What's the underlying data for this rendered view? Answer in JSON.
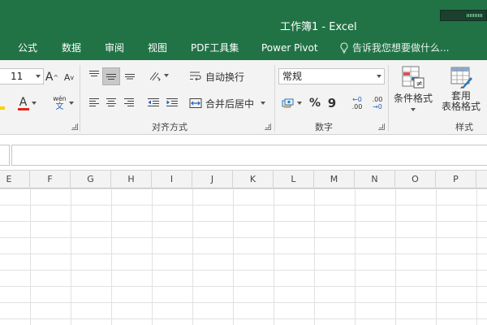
{
  "window": {
    "title": "工作簿1 - Excel"
  },
  "tabs": [
    {
      "label": "公式"
    },
    {
      "label": "数据"
    },
    {
      "label": "审阅"
    },
    {
      "label": "视图"
    },
    {
      "label": "PDF工具集"
    },
    {
      "label": "Power Pivot"
    }
  ],
  "tellme": {
    "placeholder": "告诉我您想要做什么..."
  },
  "font_group": {
    "font_size": "11",
    "phonetic_top": "wén",
    "phonetic_bottom": "文",
    "grow_label": "A",
    "shrink_label": "A",
    "font_color_label": "A"
  },
  "alignment_group": {
    "label": "对齐方式",
    "wrap_text": "自动换行",
    "merge_center": "合并后居中"
  },
  "number_group": {
    "label": "数字",
    "format": "常规",
    "percent": "%",
    "comma": "9",
    "increase_decimal": ".00",
    "decrease_decimal": ".00"
  },
  "styles_group": {
    "label": "样式",
    "conditional_formatting": "条件格式",
    "format_as_table_line1": "套用",
    "format_as_table_line2": "表格格式"
  },
  "columns": [
    "E",
    "F",
    "G",
    "H",
    "I",
    "J",
    "K",
    "L",
    "M",
    "N",
    "O",
    "P"
  ],
  "colors": {
    "brand_green": "#217346",
    "font_color_red": "#e0261c",
    "highlight_yellow": "#f5d400"
  }
}
